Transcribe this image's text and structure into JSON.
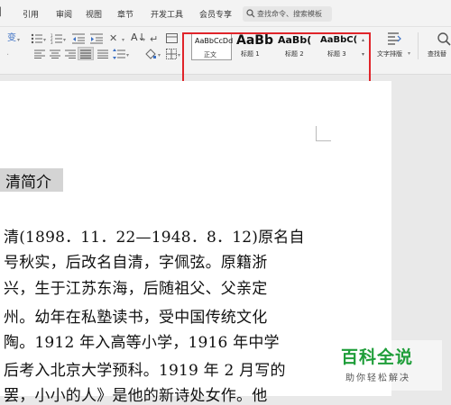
{
  "ribbon": {
    "tabs": [
      "引用",
      "审阅",
      "视图",
      "章节",
      "开发工具",
      "会员专享"
    ],
    "search_placeholder": "查找命令、搜索模板",
    "styles": [
      {
        "sample": "AaBbCcDd",
        "name": "正文"
      },
      {
        "sample": "AaBb",
        "name": "标题 1"
      },
      {
        "sample": "AaBb(",
        "name": "标题 2"
      },
      {
        "sample": "AaBbC(",
        "name": "标题 3"
      }
    ],
    "text_layout_label": "文字排版",
    "find_replace_label": "查找替"
  },
  "document": {
    "heading": "清简介",
    "lines": [
      "清(1898．11．22—1948．8．12)原名自",
      "号秋实，后改名自清，字佩弦。原籍浙",
      "兴，生于江苏东海，后随祖父、父亲定",
      "州。幼年在私塾读书，受中国传统文化",
      "陶。1912 年入高等小学，1916 年中学",
      "后考入北京大学预科。1919 年 2 月写的",
      "罢，小小的人》是他的新诗处女作。他"
    ]
  },
  "watermark": {
    "title": "百科全说",
    "subtitle": "助你轻松解决"
  },
  "colors": {
    "annotation_red": "#e0242a",
    "watermark_green": "#1f9e3a"
  }
}
